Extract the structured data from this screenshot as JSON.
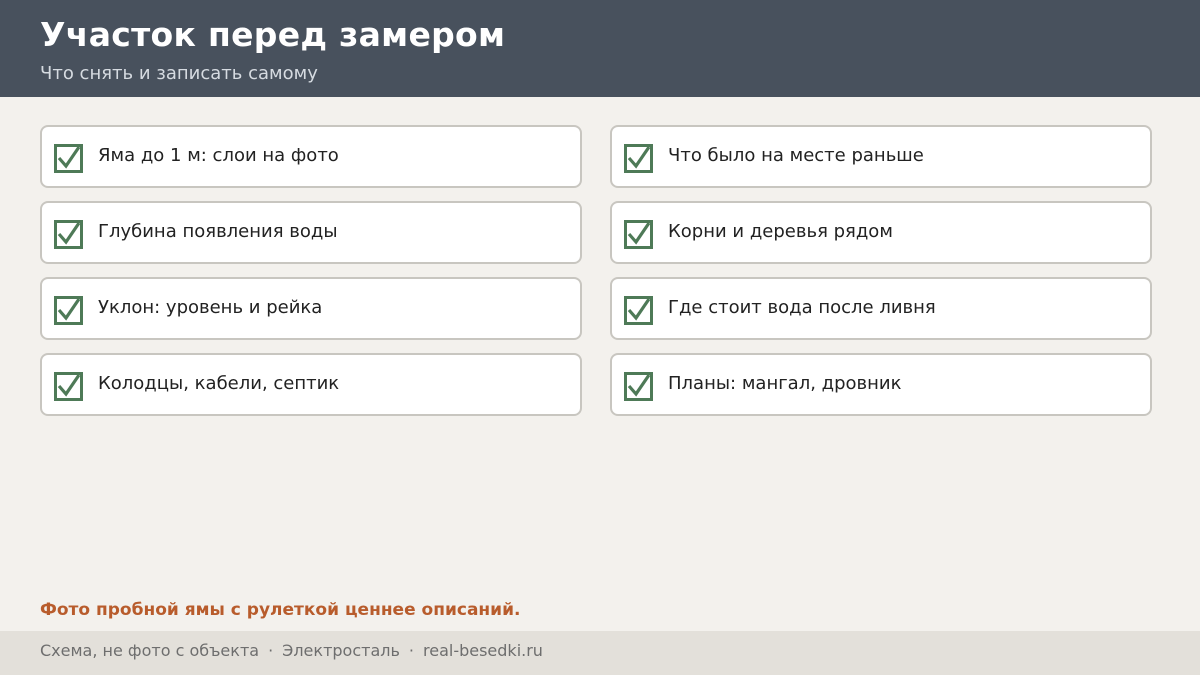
{
  "header": {
    "title": "Участок перед замером",
    "subtitle": "Что снять и записать самому"
  },
  "checklist": {
    "left": [
      {
        "label": "Яма до 1 м: слои на фото",
        "checked": true
      },
      {
        "label": "Глубина появления воды",
        "checked": true
      },
      {
        "label": "Уклон: уровень и рейка",
        "checked": true
      },
      {
        "label": "Колодцы, кабели, септик",
        "checked": true
      }
    ],
    "right": [
      {
        "label": "Что было на месте раньше",
        "checked": true
      },
      {
        "label": "Корни и деревья рядом",
        "checked": true
      },
      {
        "label": "Где стоит вода после ливня",
        "checked": true
      },
      {
        "label": "Планы: мангал, дровник",
        "checked": true
      }
    ]
  },
  "note": "Фото пробной ямы с рулеткой ценнее описаний.",
  "footer": {
    "disclaimer": "Схема, не фото с объекта",
    "separator": "·",
    "city": "Электросталь",
    "site": "real-besedki.ru"
  },
  "colors": {
    "header_bg": "#48515d",
    "check_green": "#4e7a57",
    "note_orange": "#b85c2c"
  },
  "icons": {
    "checkbox": "checked-checkbox-icon"
  }
}
